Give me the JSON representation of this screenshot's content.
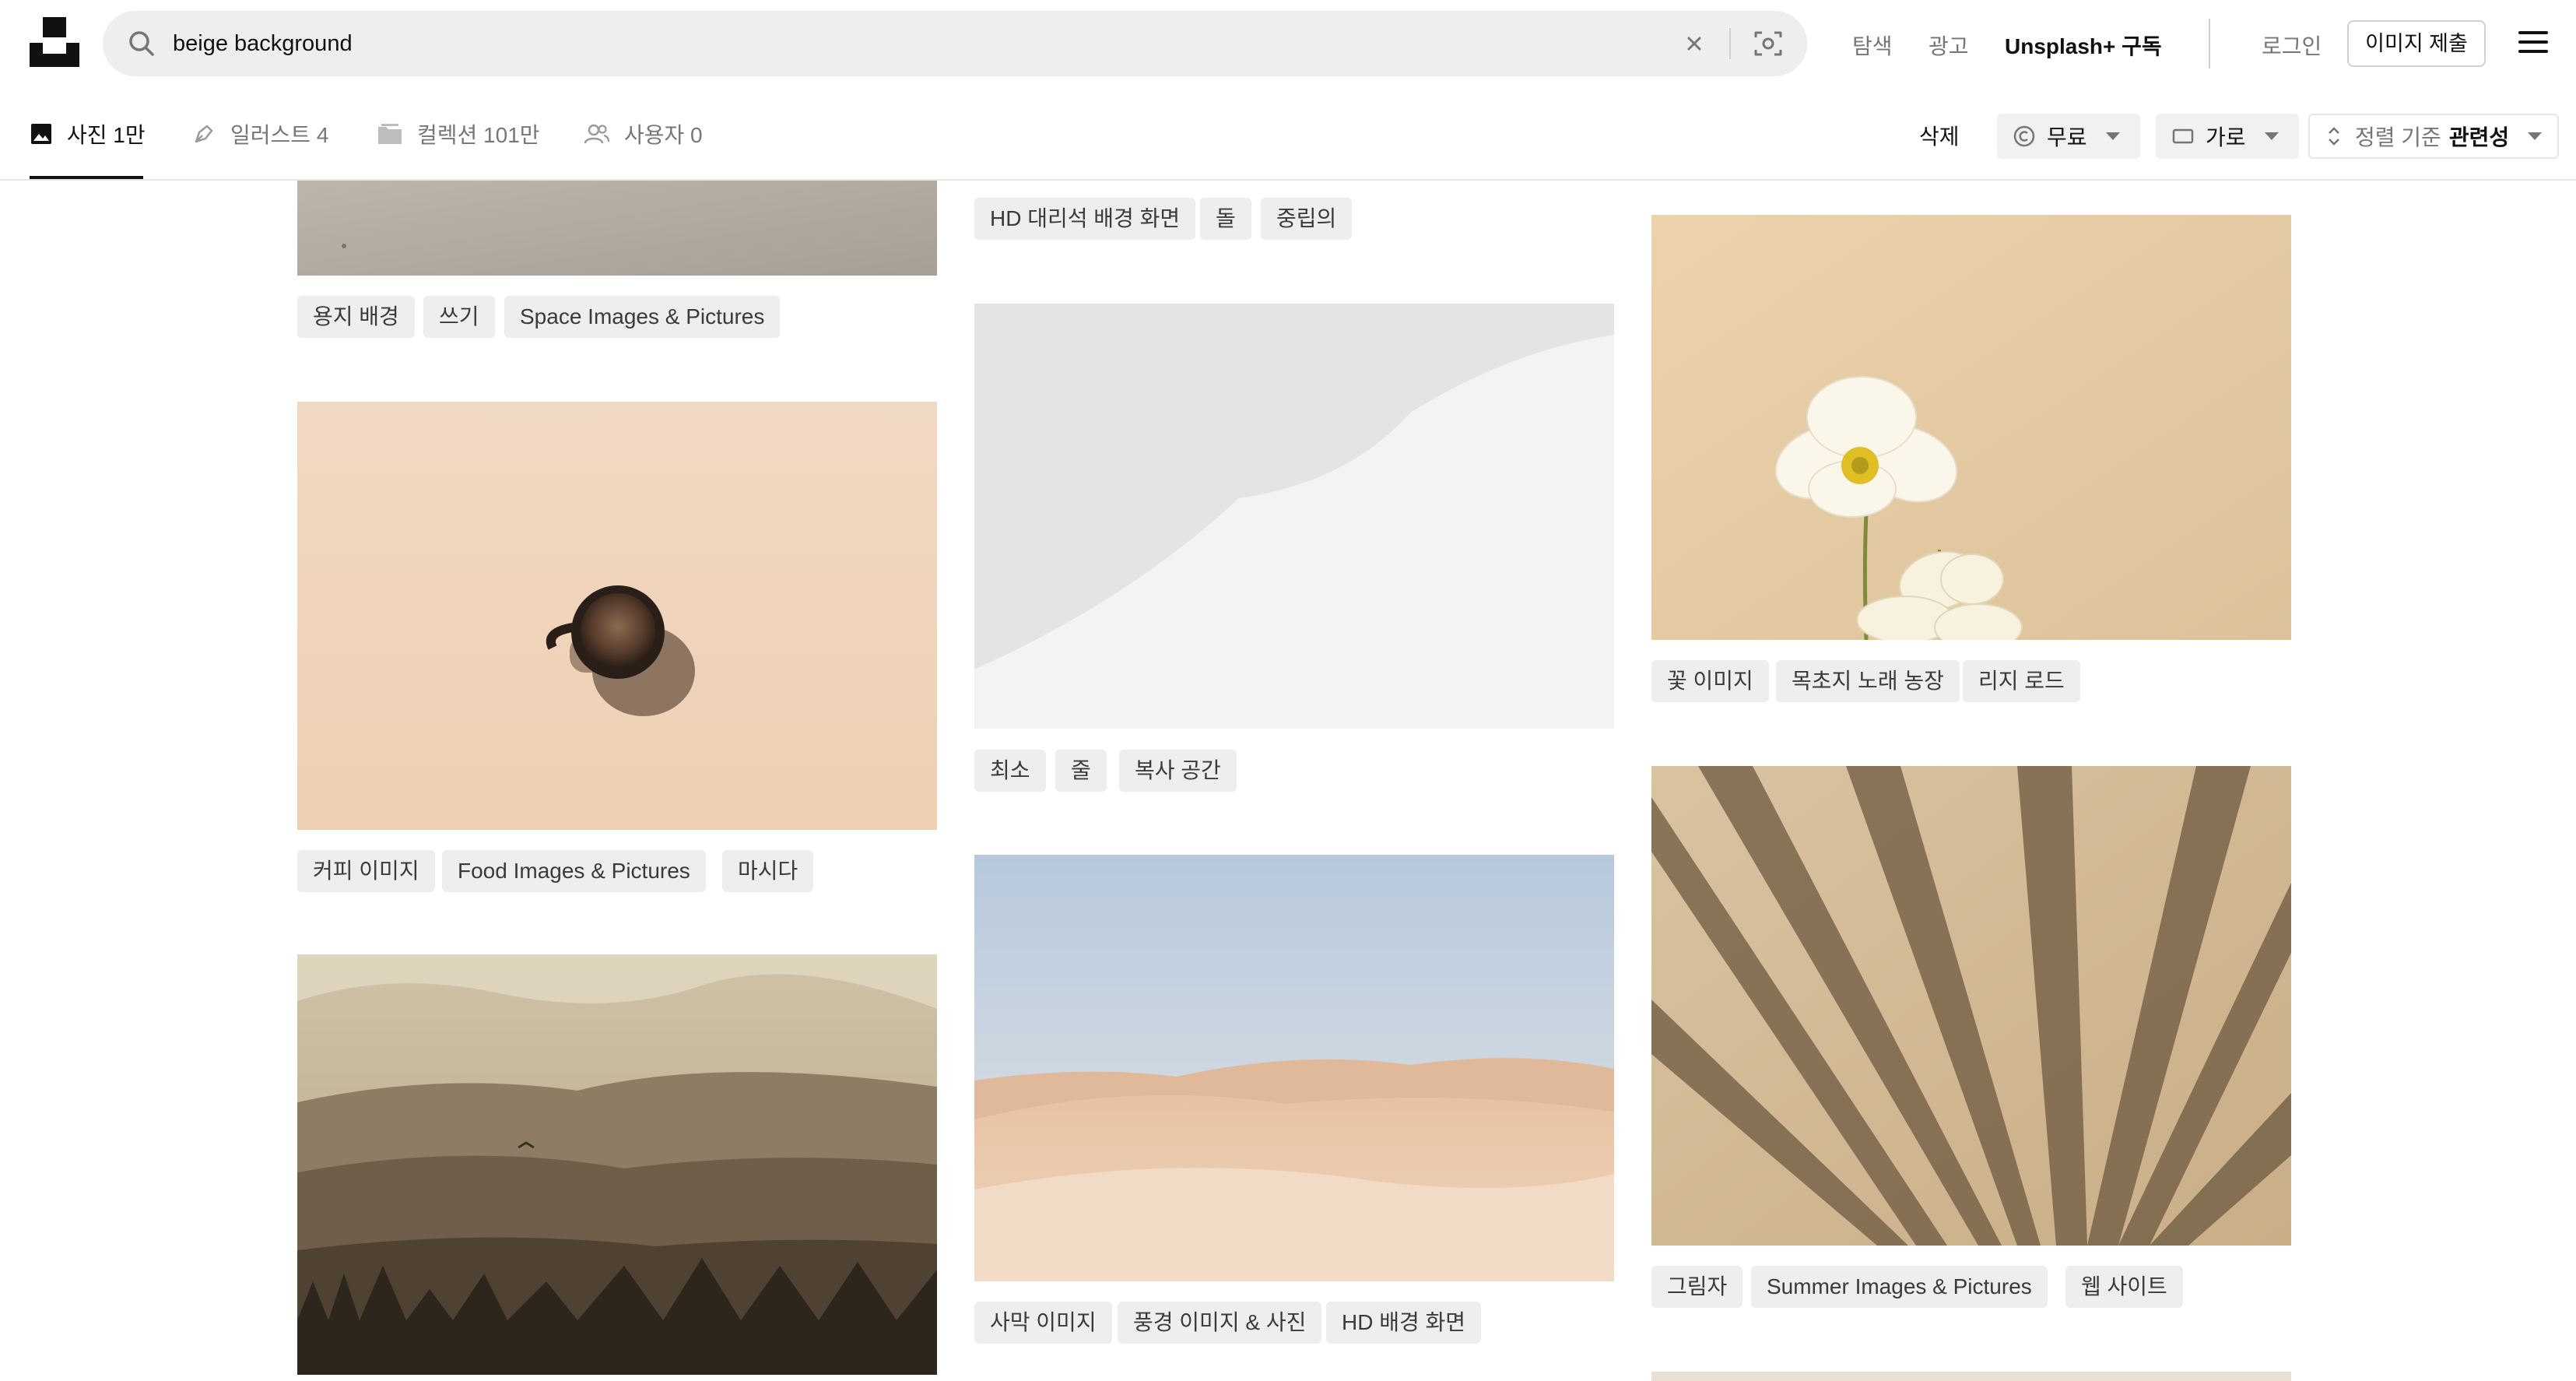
{
  "header": {
    "search_value": "beige background",
    "nav": {
      "explore": "탐색",
      "ads": "광고",
      "plus": "Unsplash+ 구독"
    },
    "login": "로그인",
    "submit": "이미지 제출"
  },
  "filters": {
    "tabs": [
      {
        "label": "사진 1만",
        "active": true
      },
      {
        "label": "일러스트 4",
        "active": false
      },
      {
        "label": "컬렉션 101만",
        "active": false
      },
      {
        "label": "사용자 0",
        "active": false
      }
    ],
    "clear": "삭제",
    "license": "무료",
    "orientation": "가로",
    "sort_prefix": "정렬 기준",
    "sort_value": "관련성"
  },
  "grid": {
    "col1": [
      {
        "tags": [
          "용지 배경",
          "쓰기",
          "Space Images & Pictures"
        ]
      },
      {
        "tags": [
          "커피 이미지",
          "Food Images & Pictures",
          "마시다"
        ]
      },
      {
        "tags": []
      }
    ],
    "col2": [
      {
        "tags": [
          "HD 대리석 배경 화면",
          "돌",
          "중립의"
        ]
      },
      {
        "tags": [
          "최소",
          "줄",
          "복사 공간"
        ]
      },
      {
        "tags": [
          "사막 이미지",
          "풍경 이미지 & 사진",
          "HD 배경 화면"
        ]
      }
    ],
    "col3": [
      {
        "tags": [
          "꽃 이미지",
          "목초지 노래 농장",
          "리지 로드"
        ]
      },
      {
        "tags": [
          "그림자",
          "Summer Images & Pictures",
          "웹 사이트"
        ]
      }
    ]
  }
}
